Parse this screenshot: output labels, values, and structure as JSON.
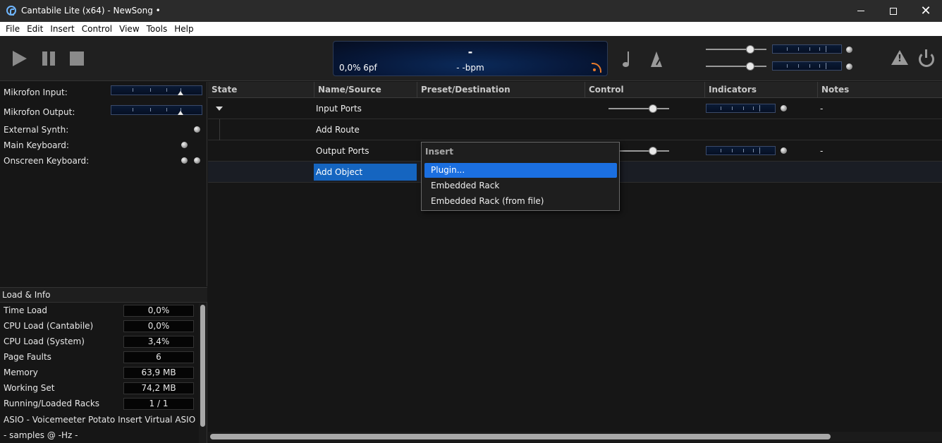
{
  "window": {
    "title": "Cantabile Lite (x64) - NewSong •"
  },
  "menu": {
    "items": [
      "File",
      "Edit",
      "Insert",
      "Control",
      "View",
      "Tools",
      "Help"
    ]
  },
  "transport": {
    "lcd_main": "-",
    "lcd_left": "0,0%  6pf",
    "lcd_bpm": "- -bpm"
  },
  "ports": [
    {
      "label": "Mikrofon Input:",
      "kind": "meter"
    },
    {
      "label": "Mikrofon Output:",
      "kind": "meter"
    },
    {
      "label": "External Synth:",
      "kind": "led"
    },
    {
      "label": "Main Keyboard:",
      "kind": "led"
    },
    {
      "label": "Onscreen Keyboard:",
      "kind": "led2"
    }
  ],
  "load_info": {
    "header": "Load & Info",
    "rows": [
      {
        "label": "Time Load",
        "value": "0,0%"
      },
      {
        "label": "CPU Load (Cantabile)",
        "value": "0,0%"
      },
      {
        "label": "CPU Load (System)",
        "value": "3,4%"
      },
      {
        "label": "Page Faults",
        "value": "6"
      },
      {
        "label": "Memory",
        "value": "63,9 MB"
      },
      {
        "label": "Working Set",
        "value": "74,2 MB"
      },
      {
        "label": "Running/Loaded Racks",
        "value": "1 / 1"
      }
    ],
    "asio_line": "ASIO - Voicemeeter Potato Insert Virtual ASIO",
    "samples_line": "- samples @ -Hz -"
  },
  "table": {
    "columns": [
      "State",
      "Name/Source",
      "Preset/Destination",
      "Control",
      "Indicators",
      "Notes"
    ],
    "rows": [
      {
        "name": "Input Ports",
        "notes": "-"
      },
      {
        "name": "Add Route",
        "notes": ""
      },
      {
        "name": "Output Ports",
        "notes": "-"
      },
      {
        "name": "Add Object",
        "notes": ""
      }
    ]
  },
  "insert_menu": {
    "title": "Insert",
    "items": [
      "Plugin...",
      "Embedded Rack",
      "Embedded Rack (from file)"
    ]
  },
  "colors": {
    "accent": "#1565c0",
    "menu_hover": "#1b6fe0",
    "lcd_bg": "#07183a",
    "rss": "#e87a2a"
  }
}
